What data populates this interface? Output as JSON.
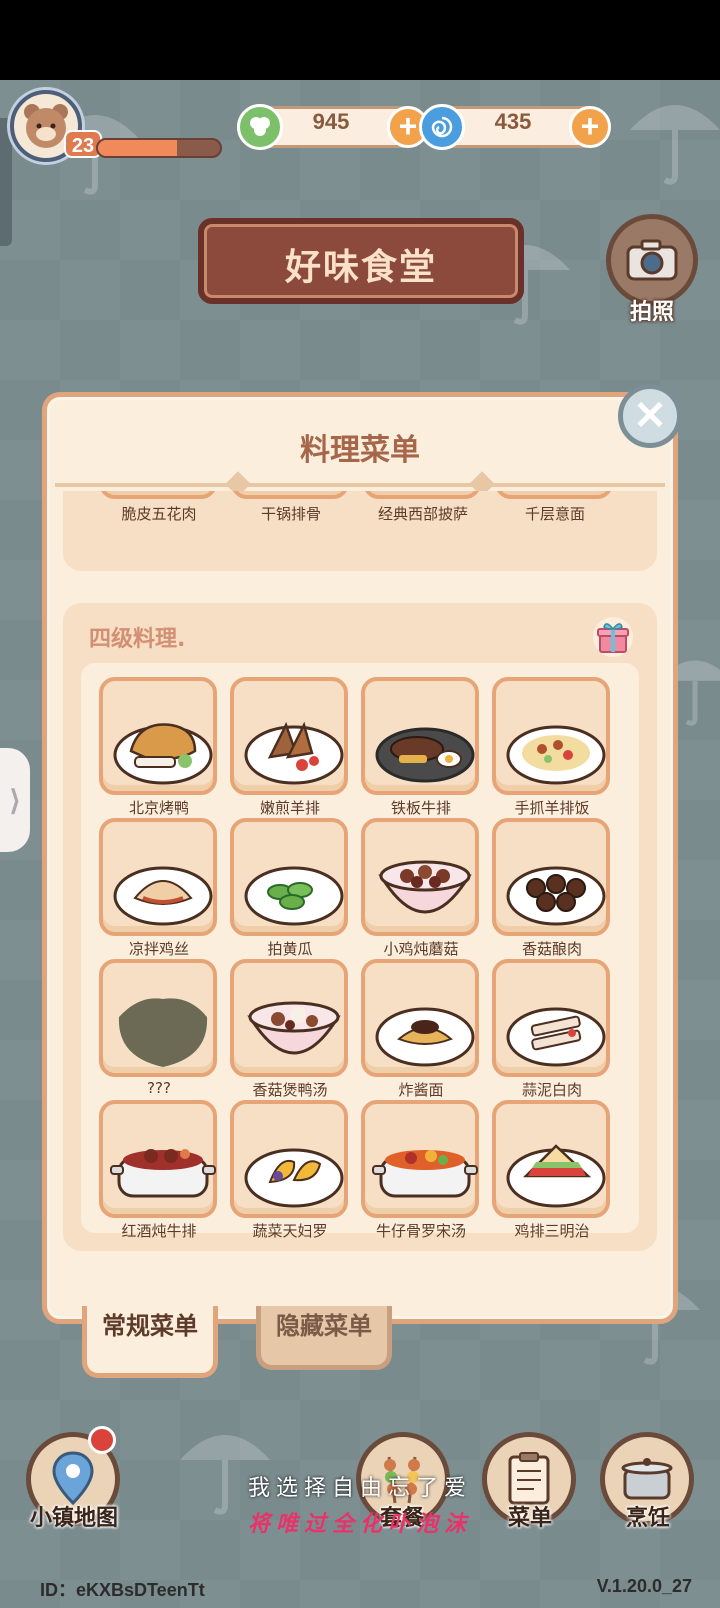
{
  "player": {
    "level": "23",
    "xp_progress": 0.65
  },
  "currencies": [
    {
      "name": "clover",
      "icon": "clover-icon",
      "value": "945",
      "color": "#7cc16a"
    },
    {
      "name": "swirl",
      "icon": "swirl-icon",
      "value": "435",
      "color": "#4a9ee0"
    }
  ],
  "restaurant_sign": "好味食堂",
  "camera": {
    "label": "拍照"
  },
  "panel": {
    "title": "料理菜单",
    "previous_row": [
      "脆皮五花肉",
      "干锅排骨",
      "经典西部披萨",
      "千层意面"
    ],
    "section_title": "四级料理.",
    "dishes": [
      {
        "name": "北京烤鸭",
        "icon": "roast-duck-icon"
      },
      {
        "name": "嫩煎羊排",
        "icon": "lamb-chops-icon"
      },
      {
        "name": "铁板牛排",
        "icon": "steak-icon"
      },
      {
        "name": "手抓羊排饭",
        "icon": "lamb-rice-icon"
      },
      {
        "name": "凉拌鸡丝",
        "icon": "shredded-chicken-icon"
      },
      {
        "name": "拍黄瓜",
        "icon": "cucumber-salad-icon"
      },
      {
        "name": "小鸡炖蘑菇",
        "icon": "chicken-mushroom-stew-icon"
      },
      {
        "name": "香菇酿肉",
        "icon": "stuffed-mushroom-icon"
      },
      {
        "name": "???",
        "icon": "locked-dish-icon"
      },
      {
        "name": "香菇煲鸭汤",
        "icon": "duck-soup-icon"
      },
      {
        "name": "炸酱面",
        "icon": "zhajiang-noodles-icon"
      },
      {
        "name": "蒜泥白肉",
        "icon": "garlic-pork-icon"
      },
      {
        "name": "红酒炖牛排",
        "icon": "wine-beef-stew-icon"
      },
      {
        "name": "蔬菜天妇罗",
        "icon": "tempura-icon"
      },
      {
        "name": "牛仔骨罗宋汤",
        "icon": "borscht-icon"
      },
      {
        "name": "鸡排三明治",
        "icon": "sandwich-icon"
      }
    ]
  },
  "tabs": {
    "regular": "常规菜单",
    "hidden": "隐藏菜单"
  },
  "bottom_nav": {
    "map": "小镇地图",
    "set_meal": "套餐",
    "menu": "菜单",
    "cook": "烹饪"
  },
  "subtitles": {
    "line1": "我选择自由忘了爱",
    "line2": "将唯过全化卟泡沫"
  },
  "footer": {
    "id": "ID：eKXBsDTeenTt",
    "version": "V.1.20.0_27"
  }
}
